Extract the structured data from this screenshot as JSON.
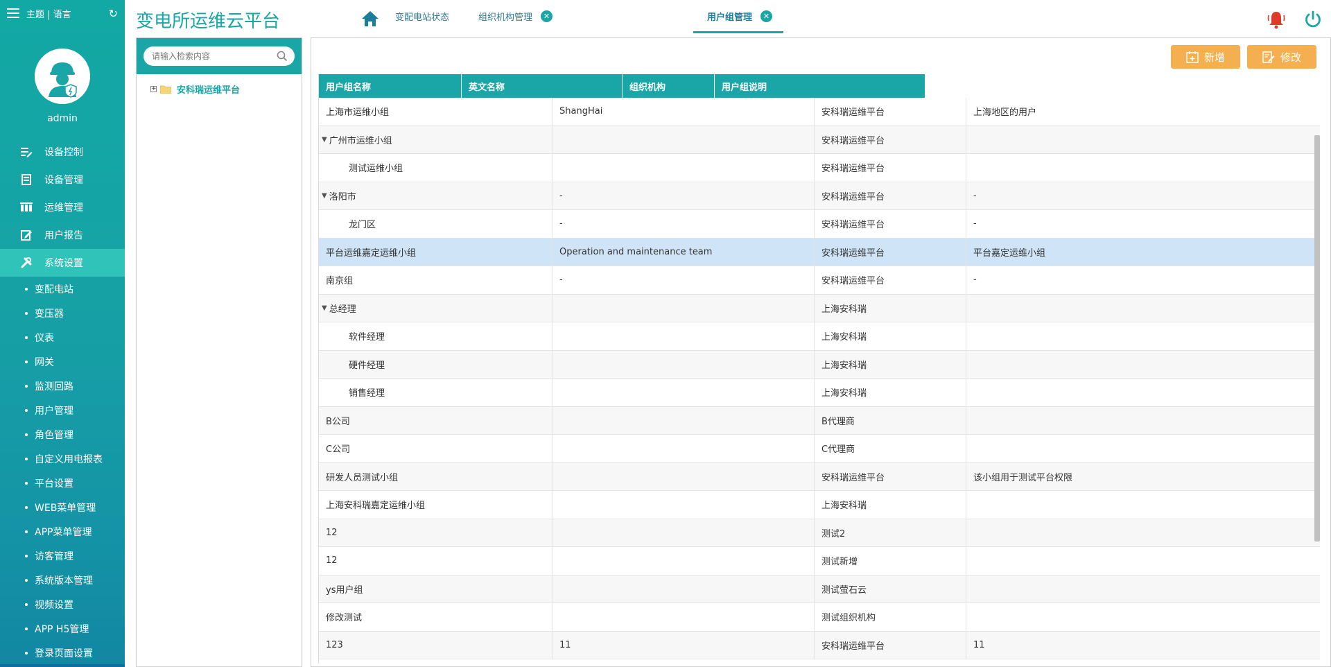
{
  "sidebar": {
    "theme_lang": "主题 | 语言",
    "username": "admin",
    "menu": [
      {
        "label": "设备控制",
        "icon": "device-control-icon"
      },
      {
        "label": "设备管理",
        "icon": "device-manage-icon"
      },
      {
        "label": "运维管理",
        "icon": "ops-manage-icon"
      },
      {
        "label": "用户报告",
        "icon": "report-icon"
      },
      {
        "label": "系统设置",
        "icon": "tools-icon"
      }
    ],
    "submenu": [
      "变配电站",
      "变压器",
      "仪表",
      "网关",
      "监测回路",
      "用户管理",
      "角色管理",
      "自定义用电报表",
      "平台设置",
      "WEB菜单管理",
      "APP菜单管理",
      "访客管理",
      "系统版本管理",
      "视频设置",
      "APP H5管理",
      "登录页面设置"
    ]
  },
  "header": {
    "title": "变电所运维云平台",
    "tabs": [
      {
        "label": "变配电站状态",
        "closable": false
      },
      {
        "label": "组织机构管理",
        "closable": true
      },
      {
        "label": "用户组管理",
        "closable": true,
        "active": true
      }
    ],
    "colors": {
      "accent": "#1aa6a6",
      "alert": "#e03a2a",
      "button": "#f4b050"
    }
  },
  "tree": {
    "search_placeholder": "请输入检索内容",
    "root": "安科瑞运维平台"
  },
  "toolbar": {
    "add_label": "新增",
    "edit_label": "修改"
  },
  "table": {
    "headers": [
      "用户组名称",
      "英文名称",
      "组织机构",
      "用户组说明"
    ],
    "rows": [
      [
        "上海市运维小组",
        "ShangHai",
        "安科瑞运维平台",
        "上海地区的用户"
      ],
      [
        "广州市运维小组",
        "",
        "安科瑞运维平台",
        ""
      ],
      [
        "测试运维小组",
        "",
        "安科瑞运维平台",
        ""
      ],
      [
        "洛阳市",
        "-",
        "安科瑞运维平台",
        "-"
      ],
      [
        "龙门区",
        "-",
        "安科瑞运维平台",
        "-"
      ],
      [
        "平台运维嘉定运维小组",
        "Operation and maintenance team",
        "安科瑞运维平台",
        "平台嘉定运维小组"
      ],
      [
        "南京组",
        "-",
        "安科瑞运维平台",
        "-"
      ],
      [
        "总经理",
        "",
        "上海安科瑞",
        ""
      ],
      [
        "软件经理",
        "",
        "上海安科瑞",
        ""
      ],
      [
        "硬件经理",
        "",
        "上海安科瑞",
        ""
      ],
      [
        "销售经理",
        "",
        "上海安科瑞",
        ""
      ],
      [
        "B公司",
        "",
        "B代理商",
        ""
      ],
      [
        "C公司",
        "",
        "C代理商",
        ""
      ],
      [
        "研发人员测试小组",
        "",
        "安科瑞运维平台",
        "该小组用于测试平台权限"
      ],
      [
        "上海安科瑞嘉定运维小组",
        "",
        "上海安科瑞",
        ""
      ],
      [
        "12",
        "",
        "测试2",
        ""
      ],
      [
        "12",
        "",
        "测试新增",
        ""
      ],
      [
        "ys用户组",
        "",
        "测试萤石云",
        ""
      ],
      [
        "修改测试",
        "",
        "测试组织机构",
        ""
      ],
      [
        "123",
        "11",
        "安科瑞运维平台",
        "11"
      ]
    ]
  }
}
